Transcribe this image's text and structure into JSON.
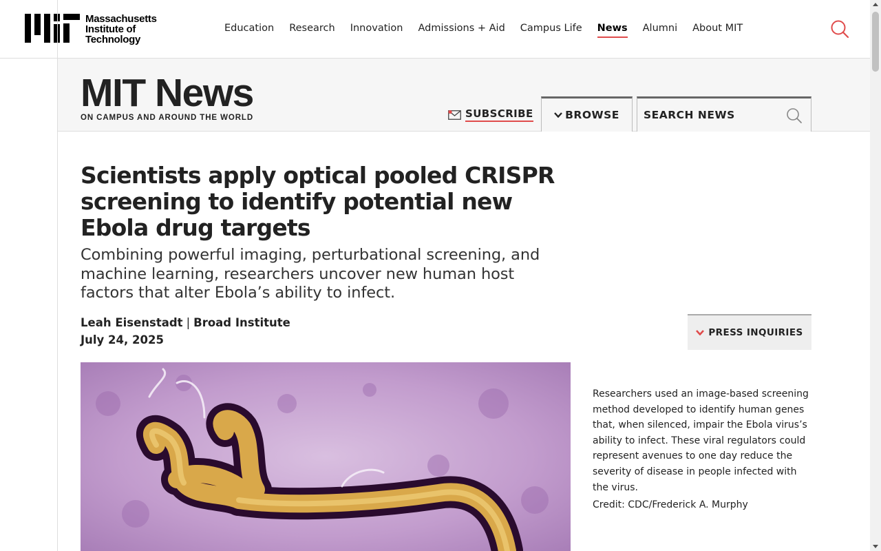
{
  "site": {
    "logo_text": [
      "Massachusetts",
      "Institute of",
      "Technology"
    ],
    "accent_color": "#e04b4b"
  },
  "nav": {
    "items": [
      {
        "label": "Education"
      },
      {
        "label": "Research"
      },
      {
        "label": "Innovation"
      },
      {
        "label": "Admissions + Aid"
      },
      {
        "label": "Campus Life"
      },
      {
        "label": "News",
        "active": true
      },
      {
        "label": "Alumni"
      },
      {
        "label": "About MIT"
      }
    ],
    "search_icon": "search-icon"
  },
  "news_header": {
    "title": "MIT News",
    "tagline": "ON CAMPUS AND AROUND THE WORLD",
    "subscribe_label": "SUBSCRIBE",
    "browse_label": "BROWSE",
    "search_placeholder": "SEARCH NEWS"
  },
  "article": {
    "headline": "Scientists apply optical pooled CRISPR screening to identify potential new Ebola drug targets",
    "dek": "Combining powerful imaging, perturbational screening, and machine learning, researchers uncover new human host factors that alter Ebola’s ability to infect.",
    "author": "Leah Eisenstadt",
    "affiliation": "Broad Institute",
    "byline_separator": "|",
    "date": "July 24, 2025",
    "press_inquiries_label": "PRESS INQUIRIES",
    "caption": "Researchers used an image-based screening method developed to identify human genes that, when silenced, impair the Ebola virus’s ability to infect. These viral regulators could represent avenues to one day reduce the severity of disease in people infected with the virus.",
    "credit": "Credit: CDC/Frederick A. Murphy"
  }
}
